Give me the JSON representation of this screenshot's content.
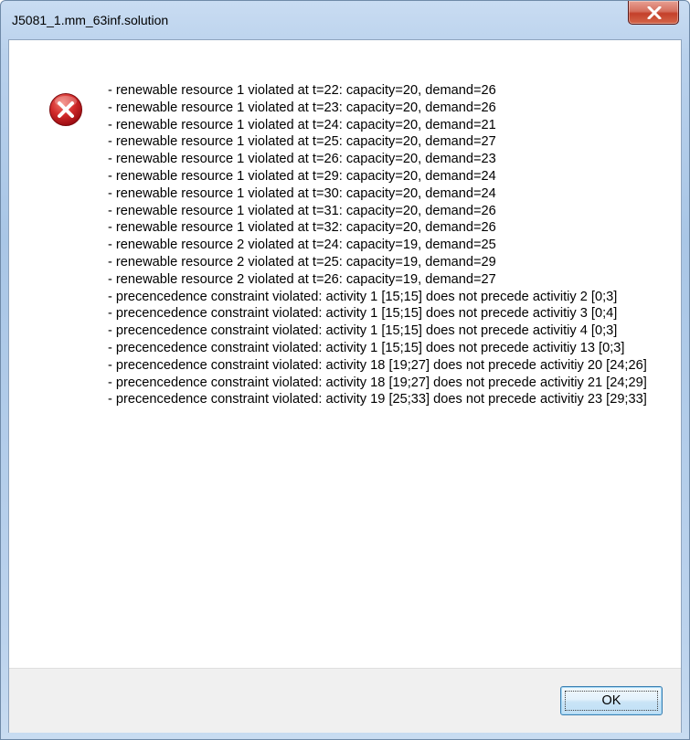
{
  "window": {
    "title": "J5081_1.mm_63inf.solution",
    "close_icon": "close-icon"
  },
  "dialog": {
    "icon": "error-icon",
    "lines": [
      "- renewable resource 1 violated at t=22: capacity=20, demand=26",
      "- renewable resource 1 violated at t=23: capacity=20, demand=26",
      "- renewable resource 1 violated at t=24: capacity=20, demand=21",
      "- renewable resource 1 violated at t=25: capacity=20, demand=27",
      "- renewable resource 1 violated at t=26: capacity=20, demand=23",
      "- renewable resource 1 violated at t=29: capacity=20, demand=24",
      "- renewable resource 1 violated at t=30: capacity=20, demand=24",
      "- renewable resource 1 violated at t=31: capacity=20, demand=26",
      "- renewable resource 1 violated at t=32: capacity=20, demand=26",
      "- renewable resource 2 violated at t=24: capacity=19, demand=25",
      "- renewable resource 2 violated at t=25: capacity=19, demand=29",
      "- renewable resource 2 violated at t=26: capacity=19, demand=27",
      "- precencedence constraint violated: activity 1 [15;15] does not precede activitiy 2 [0;3]",
      "- precencedence constraint violated: activity 1 [15;15] does not precede activitiy 3 [0;4]",
      "- precencedence constraint violated: activity 1 [15;15] does not precede activitiy 4 [0;3]",
      "- precencedence constraint violated: activity 1 [15;15] does not precede activitiy 13 [0;3]",
      "- precencedence constraint violated: activity 18 [19;27] does not precede activitiy 20 [24;26]",
      "- precencedence constraint violated: activity 18 [19;27] does not precede activitiy 21 [24;29]",
      "- precencedence constraint violated: activity 19 [25;33] does not precede activitiy 23 [29;33]"
    ],
    "ok_label": "OK"
  },
  "colors": {
    "close_button": "#c4402a",
    "error_icon": "#c8141e",
    "ok_border": "#3c7fb1"
  }
}
